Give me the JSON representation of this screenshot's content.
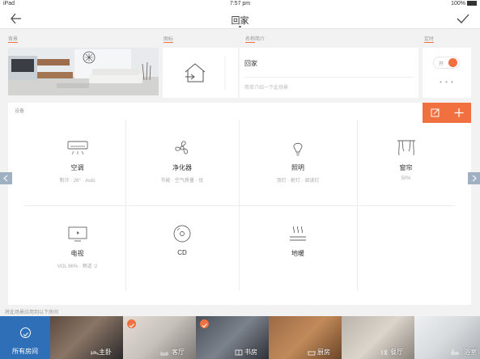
{
  "status_bar": {
    "device": "iPad",
    "time": "7:57 pm",
    "battery": "100%"
  },
  "nav": {
    "title": "回家"
  },
  "sections": {
    "background": "背景",
    "icon": "图标",
    "name_intro": "名称简介",
    "timer": "定时",
    "devices": "设备"
  },
  "scene": {
    "name": "回家",
    "description": "简单介绍一下此场景"
  },
  "timer": {
    "toggle_label": "开",
    "more_label": "• • •"
  },
  "devices": [
    {
      "name": "空调",
      "status": "制冷 · 26° · Auto",
      "icon": "air-conditioner-icon"
    },
    {
      "name": "净化器",
      "status": "节能 · 空气质量 · 优",
      "icon": "fan-icon"
    },
    {
      "name": "照明",
      "status": "顶灯 · 射灯 · 阅读灯",
      "icon": "bulb-icon"
    },
    {
      "name": "窗帘",
      "status": "50%",
      "icon": "curtain-icon"
    },
    {
      "name": "电视",
      "status": "VOL 66% · 频道 :2",
      "icon": "tv-icon"
    },
    {
      "name": "CD",
      "status": "",
      "icon": "cd-icon"
    },
    {
      "name": "地暖",
      "status": "",
      "icon": "floor-heating-icon"
    }
  ],
  "hint": "将此场景应用到以下房间",
  "rooms": [
    {
      "name": "所有房间",
      "checked": false
    },
    {
      "name": "主卧",
      "checked": false
    },
    {
      "name": "客厅",
      "checked": true
    },
    {
      "name": "书房",
      "checked": true
    },
    {
      "name": "厨房",
      "checked": false
    },
    {
      "name": "餐厅",
      "checked": false
    },
    {
      "name": "浴室",
      "checked": false
    }
  ],
  "colors": {
    "accent": "#f07040",
    "rooms_all": "#2f6fb8",
    "page_arrow": "#9fb0c3"
  }
}
